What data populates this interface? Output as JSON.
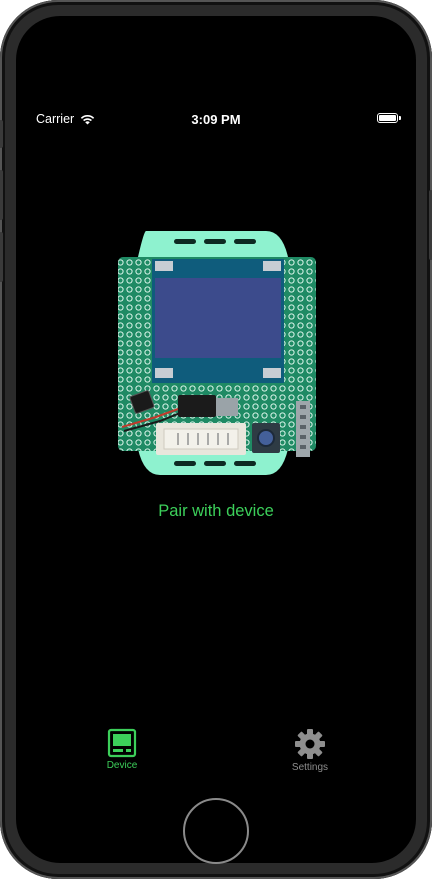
{
  "status_bar": {
    "carrier": "Carrier",
    "time": "3:09 PM",
    "icons": [
      "wifi-icon",
      "battery-icon"
    ]
  },
  "main": {
    "pair_label": "Pair with device",
    "illustration": "device-board-illustration"
  },
  "tab_bar": {
    "tabs": [
      {
        "label": "Device",
        "icon": "device-icon",
        "selected": true
      },
      {
        "label": "Settings",
        "icon": "gear-icon",
        "selected": false
      }
    ]
  },
  "colors": {
    "accent": "#3ccf5a",
    "inactive": "#8e8e8e",
    "background": "#000000",
    "board_green": "#1f8a64",
    "strap_mint": "#8ef2cf",
    "screen_blue": "#3c4b8c"
  }
}
